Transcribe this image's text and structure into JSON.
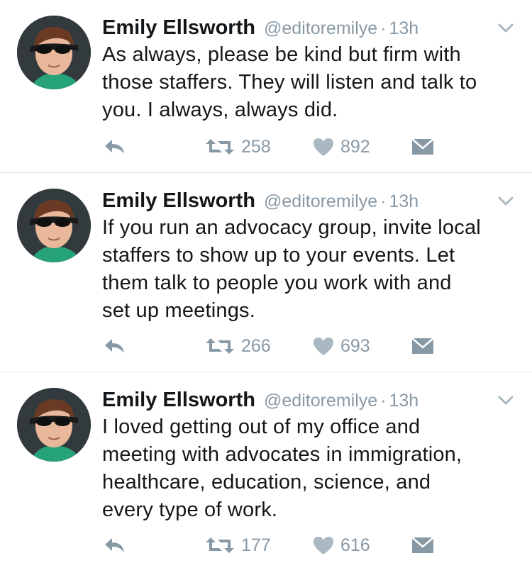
{
  "tweets": [
    {
      "name": "Emily Ellsworth",
      "handle": "@editoremilye",
      "separator": "·",
      "time": "13h",
      "lines": [
        "As always, please be kind but firm with",
        "those staffers. They will listen and talk to",
        "you. I always, always did."
      ],
      "retweets": "258",
      "likes": "892"
    },
    {
      "name": "Emily Ellsworth",
      "handle": "@editoremilye",
      "separator": "·",
      "time": "13h",
      "lines": [
        "If you run an advocacy group, invite local",
        "staffers to show up to your events. Let",
        "them talk to people you work with and",
        "set up meetings."
      ],
      "retweets": "266",
      "likes": "693"
    },
    {
      "name": "Emily Ellsworth",
      "handle": "@editoremilye",
      "separator": "·",
      "time": "13h",
      "lines": [
        "I loved getting out of my office and",
        "meeting with advocates in immigration,",
        "healthcare, education, science, and",
        "every type of work."
      ],
      "retweets": "177",
      "likes": "616"
    }
  ],
  "colors": {
    "text": "#14171a",
    "secondary": "#8899a6",
    "divider": "#dfe3e6",
    "background": "#ffffff"
  },
  "icons": [
    "chevron-down-icon",
    "reply-icon",
    "retweet-icon",
    "heart-icon",
    "envelope-icon"
  ]
}
